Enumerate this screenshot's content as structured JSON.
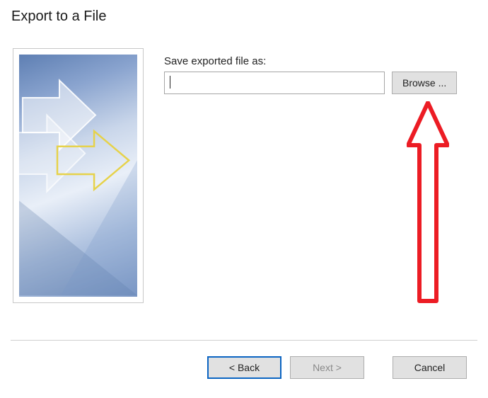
{
  "dialog": {
    "title": "Export to a File"
  },
  "form": {
    "file_label": "Save exported file as:",
    "file_value": "",
    "browse_label": "Browse ..."
  },
  "buttons": {
    "back": "< Back",
    "next": "Next >",
    "cancel": "Cancel"
  }
}
